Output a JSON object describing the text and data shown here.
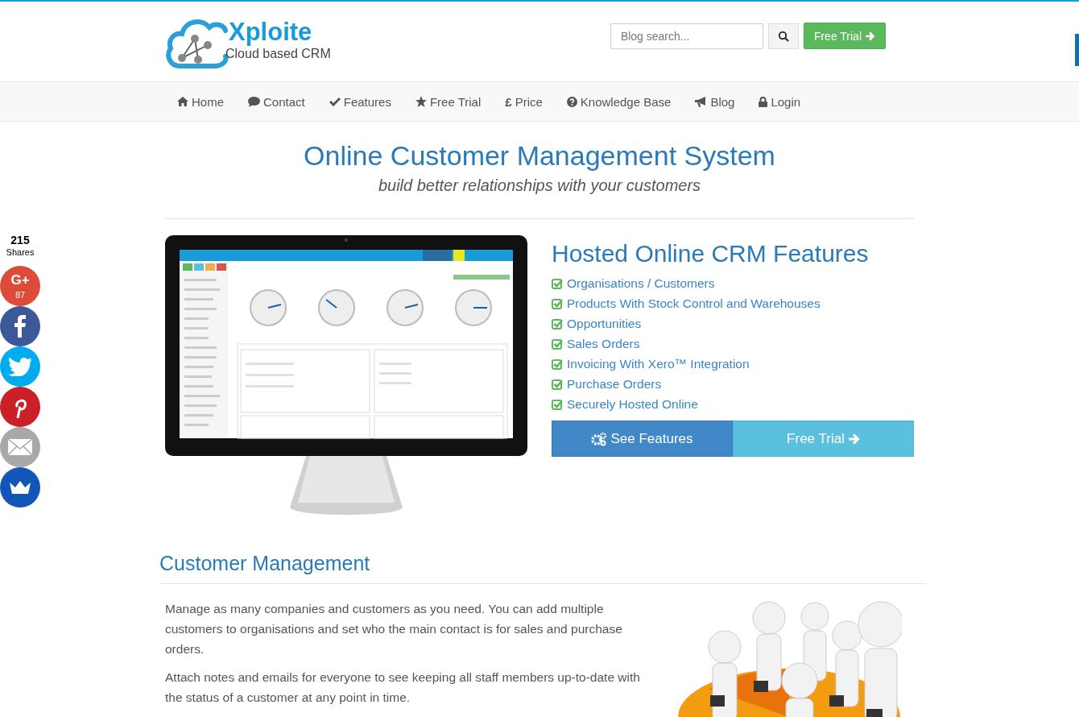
{
  "logo": {
    "name": "Xploite",
    "tagline": "Cloud based CRM"
  },
  "search": {
    "placeholder": "Blog search..."
  },
  "header_button": {
    "label": "Free Trial"
  },
  "nav": [
    {
      "label": "Home"
    },
    {
      "label": "Contact"
    },
    {
      "label": "Features"
    },
    {
      "label": "Free Trial"
    },
    {
      "label": "Price",
      "glyph": "£"
    },
    {
      "label": "Knowledge Base"
    },
    {
      "label": "Blog"
    },
    {
      "label": "Login"
    }
  ],
  "hero": {
    "title": "Online Customer Management System",
    "subtitle": "build better relationships with your customers"
  },
  "features": {
    "title": "Hosted Online CRM Features",
    "items": [
      "Organisations / Customers",
      "Products With Stock Control and Warehouses",
      "Opportunities",
      "Sales Orders",
      "Invoicing With Xero™ Integration",
      "Purchase Orders",
      "Securely Hosted Online"
    ],
    "buttons": [
      {
        "label": "See Features",
        "kind": "primary"
      },
      {
        "label": "Free Trial",
        "kind": "info"
      }
    ]
  },
  "section": {
    "title": "Customer Management",
    "paragraphs": [
      "Manage as many companies and customers as you need. You can add multiple customers to organisations and set who the main contact is for sales and purchase orders.",
      "Attach notes and emails for everyone to see keeping all staff members up-to-date with the status of a customer at any point in time."
    ]
  },
  "share": {
    "count": "215",
    "label": "Shares",
    "networks": [
      {
        "kind": "google",
        "glyph": "G+",
        "count": "87"
      },
      {
        "kind": "facebook"
      },
      {
        "kind": "twitter"
      },
      {
        "kind": "pinterest"
      },
      {
        "kind": "email"
      },
      {
        "kind": "crown"
      }
    ]
  }
}
